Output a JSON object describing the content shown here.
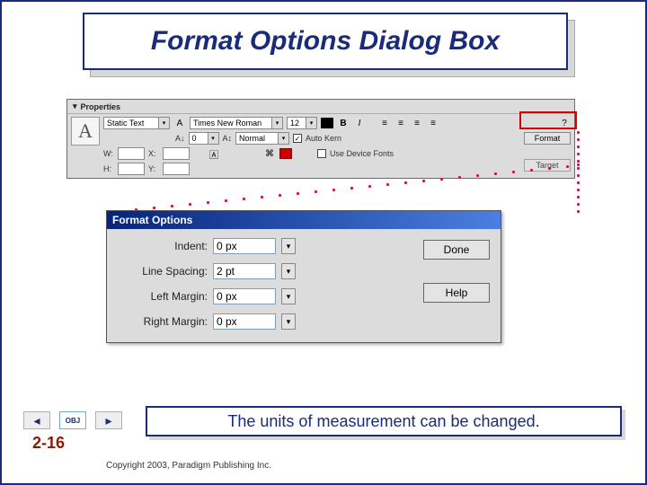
{
  "slide": {
    "title": "Format Options Dialog Box",
    "caption": "The units of measurement can be changed.",
    "page_num": "2-16",
    "copyright": "Copyright 2003, Paradigm Publishing Inc."
  },
  "nav": {
    "obj_label": "OBJ"
  },
  "properties": {
    "panel_title": "Properties",
    "type_value": "Static Text",
    "font_value": "Times New Roman",
    "font_size": "12",
    "av_value": "0",
    "ai_value": "Normal",
    "auto_kern_label": "Auto Kern",
    "use_device_fonts_label": "Use Device Fonts",
    "labels": {
      "w": "W:",
      "h": "H:",
      "x": "X:",
      "y": "Y:"
    },
    "buttons": {
      "format": "Format",
      "target": "Target"
    }
  },
  "format_options": {
    "title": "Format Options",
    "fields": {
      "indent": {
        "label": "Indent:",
        "value": "0 px"
      },
      "line_spacing": {
        "label": "Line Spacing:",
        "value": "2 pt"
      },
      "left_margin": {
        "label": "Left Margin:",
        "value": "0 px"
      },
      "right_margin": {
        "label": "Right Margin:",
        "value": "0 px"
      }
    },
    "buttons": {
      "done": "Done",
      "help": "Help"
    }
  },
  "colors": {
    "highlight": "#d40000",
    "accent": "#1a2b7a"
  }
}
